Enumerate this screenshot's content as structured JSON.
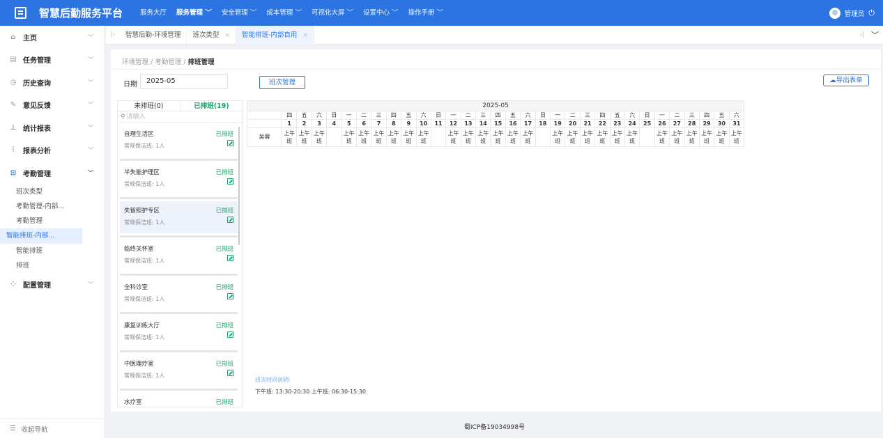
{
  "app": {
    "title": "智慧后勤服务平台"
  },
  "topnav": [
    {
      "label": "服务大厅",
      "arrow": ""
    },
    {
      "label": "服务管理",
      "arrow": " ﹀",
      "active": true
    },
    {
      "label": "安全管理",
      "arrow": " ﹀"
    },
    {
      "label": "成本管理",
      "arrow": " ﹀"
    },
    {
      "label": "可视化大屏",
      "arrow": " ﹀"
    },
    {
      "label": "设置中心",
      "arrow": " ﹀"
    },
    {
      "label": "操作手册",
      "arrow": " ﹀"
    }
  ],
  "user": {
    "name": "管理员",
    "power_icon": "⏻"
  },
  "sidebar": {
    "items": [
      {
        "icon": "home-icon",
        "glyph": "⌂",
        "label": "主页"
      },
      {
        "icon": "task-icon",
        "glyph": "▤",
        "label": "任务管理"
      },
      {
        "icon": "history-icon",
        "glyph": "◷",
        "label": "历史查询"
      },
      {
        "icon": "feedback-icon",
        "glyph": "✎",
        "label": "意见反馈"
      },
      {
        "icon": "stats-icon",
        "glyph": "⊥",
        "label": "统计报表"
      },
      {
        "icon": "analysis-icon",
        "glyph": "⫶",
        "label": "报表分析"
      },
      {
        "icon": "attendance-icon",
        "glyph": "⊡",
        "label": "考勤管理",
        "open": true
      }
    ],
    "subitems": [
      {
        "label": "班次类型"
      },
      {
        "label": "考勤管理-内部..."
      },
      {
        "label": "考勤管理"
      },
      {
        "label": "智能排班-内部...",
        "active": true
      },
      {
        "label": "智能排班"
      },
      {
        "label": "排班"
      }
    ],
    "after": [
      {
        "icon": "config-icon",
        "glyph": "⁘",
        "label": "配置管理"
      }
    ],
    "collapse_label": "收起导航",
    "collapse_glyph": "☰"
  },
  "tabs": [
    {
      "label": "智慧后勤-环境管理",
      "closable": false
    },
    {
      "label": "班次类型",
      "closable": true
    },
    {
      "label": "智能排班-内部自用",
      "closable": true,
      "active": true
    }
  ],
  "breadcrumb": {
    "items": [
      "环境管理",
      "考勤管理"
    ],
    "current": "排班管理",
    "sep": " / "
  },
  "filters": {
    "date_label": "日期",
    "date_value": "2025-05",
    "shift_button": "班次管理",
    "export_button": "导出表单"
  },
  "list": {
    "tab_unscheduled": "未排班(0)",
    "tab_scheduled": "已排班(19)",
    "search_placeholder": "请输入",
    "areas": [
      {
        "name": "自理生活区",
        "sub": "常规保洁班: 1人",
        "status": "已排班"
      },
      {
        "name": "半失能护理区",
        "sub": "常规保洁班: 1人",
        "status": "已排班"
      },
      {
        "name": "失智照护专区",
        "sub": "常规保洁班: 1人",
        "status": "已排班"
      },
      {
        "name": "临终关怀室",
        "sub": "常规保洁班: 1人",
        "status": "已排班"
      },
      {
        "name": "全科诊室",
        "sub": "常规保洁班: 1人",
        "status": "已排班"
      },
      {
        "name": "康复训练大厅",
        "sub": "常规保洁班: 1人",
        "status": "已排班"
      },
      {
        "name": "中医理疗室",
        "sub": "常规保洁班: 1人",
        "status": "已排班"
      },
      {
        "name": "水疗室",
        "sub": "常规保洁班: 1人",
        "status": "已排班"
      }
    ]
  },
  "schedule": {
    "month": "2025-05",
    "weekdays": [
      "四",
      "五",
      "六",
      "日",
      "一",
      "二",
      "三",
      "四",
      "五",
      "六",
      "日",
      "一",
      "二",
      "三",
      "四",
      "五",
      "六",
      "日",
      "一",
      "二",
      "三",
      "四",
      "五",
      "六",
      "日",
      "一",
      "二",
      "三",
      "四",
      "五",
      "六"
    ],
    "days": [
      "1",
      "2",
      "3",
      "4",
      "5",
      "6",
      "7",
      "8",
      "9",
      "10",
      "11",
      "12",
      "13",
      "14",
      "15",
      "16",
      "17",
      "18",
      "19",
      "20",
      "21",
      "22",
      "23",
      "24",
      "25",
      "26",
      "27",
      "28",
      "29",
      "30",
      "31"
    ],
    "rows": [
      {
        "name": "吴蓉",
        "shifts": [
          "上午班",
          "上午班",
          "上午班",
          "",
          "上午班",
          "上午班",
          "上午班",
          "上午班",
          "上午班",
          "上午班",
          "",
          "上午班",
          "上午班",
          "上午班",
          "上午班",
          "上午班",
          "上午班",
          "",
          "上午班",
          "上午班",
          "上午班",
          "上午班",
          "上午班",
          "上午班",
          "",
          "上午班",
          "上午班",
          "上午班",
          "上午班",
          "上午班",
          "上午班"
        ]
      }
    ]
  },
  "legend": {
    "title": "班次时间说明:",
    "text": "下午班: 13:30-20:30    上午班: 06:30-15:30"
  },
  "footer": {
    "icp": "蜀ICP备19034998号"
  }
}
